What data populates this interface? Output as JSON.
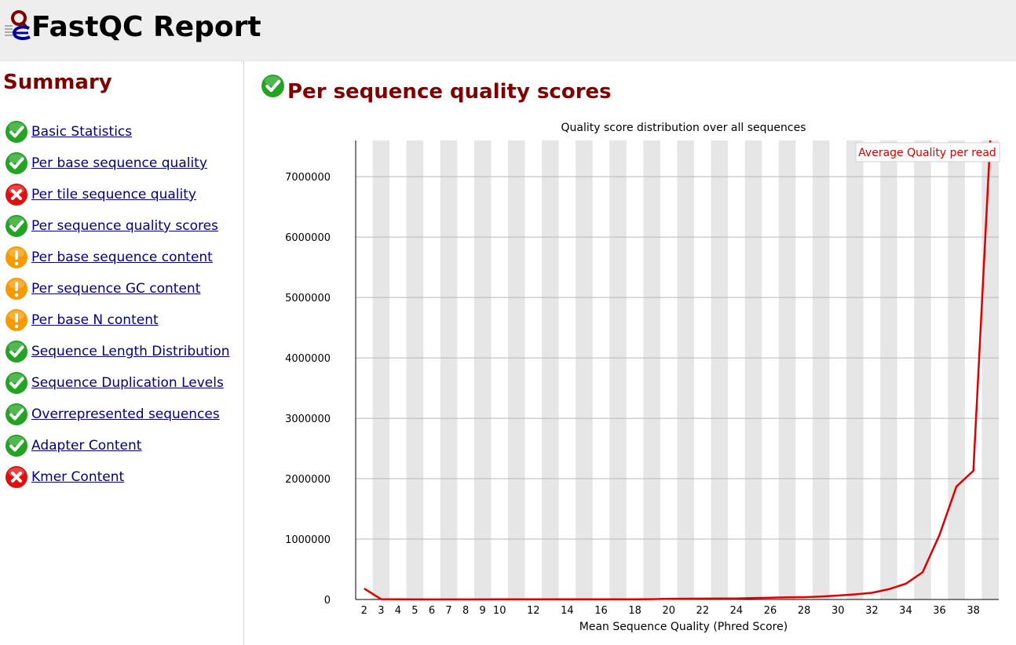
{
  "header": {
    "title": "FastQC Report"
  },
  "sidebar": {
    "title": "Summary",
    "modules": [
      {
        "label": "Basic Statistics",
        "status": "pass"
      },
      {
        "label": "Per base sequence quality",
        "status": "pass"
      },
      {
        "label": "Per tile sequence quality",
        "status": "fail"
      },
      {
        "label": "Per sequence quality scores",
        "status": "pass"
      },
      {
        "label": "Per base sequence content",
        "status": "warn"
      },
      {
        "label": "Per sequence GC content",
        "status": "warn"
      },
      {
        "label": "Per base N content",
        "status": "warn"
      },
      {
        "label": "Sequence Length Distribution",
        "status": "pass"
      },
      {
        "label": "Sequence Duplication Levels",
        "status": "pass"
      },
      {
        "label": "Overrepresented sequences",
        "status": "pass"
      },
      {
        "label": "Adapter Content",
        "status": "pass"
      },
      {
        "label": "Kmer Content",
        "status": "fail"
      }
    ]
  },
  "main": {
    "section_title": "Per sequence quality scores",
    "section_status": "pass"
  },
  "colors": {
    "title_red": "#800000",
    "link_blue": "#000080",
    "line_red": "#dd0000",
    "stripe_gray": "#e6e6e6",
    "pass_green": "#22a322",
    "warn_orange": "#f59a00",
    "fail_red": "#dd1111"
  },
  "chart_data": {
    "type": "line",
    "title": "Quality score distribution over all sequences",
    "xlabel": "Mean Sequence Quality (Phred Score)",
    "ylabel": "",
    "legend": "Average Quality per read",
    "legend_position": "top-right",
    "x_tick_labels": [
      "2",
      "3",
      "4",
      "5",
      "6",
      "7",
      "8",
      "9",
      "10",
      "12",
      "14",
      "16",
      "18",
      "20",
      "22",
      "24",
      "26",
      "28",
      "30",
      "32",
      "34",
      "36",
      "38"
    ],
    "y_ticks": [
      0,
      1000000,
      2000000,
      3000000,
      4000000,
      5000000,
      6000000,
      7000000
    ],
    "y_tick_labels": [
      "0",
      "1000000",
      "2000000",
      "3000000",
      "4000000",
      "5000000",
      "6000000",
      "7000000"
    ],
    "xlim": [
      2,
      39
    ],
    "ylim": [
      0,
      7600000
    ],
    "series": [
      {
        "name": "Average Quality per read",
        "x": [
          2,
          3,
          4,
          5,
          6,
          7,
          8,
          9,
          10,
          11,
          12,
          13,
          14,
          15,
          16,
          17,
          18,
          19,
          20,
          21,
          22,
          23,
          24,
          25,
          26,
          27,
          28,
          29,
          30,
          31,
          32,
          33,
          34,
          35,
          36,
          37,
          38,
          39
        ],
        "y": [
          180000,
          5000,
          2000,
          1500,
          1500,
          1500,
          1500,
          1500,
          2000,
          2000,
          2500,
          2500,
          3000,
          3000,
          3500,
          4000,
          4500,
          5000,
          12000,
          13000,
          14000,
          15000,
          16000,
          25000,
          28000,
          35000,
          38000,
          50000,
          65000,
          85000,
          110000,
          170000,
          260000,
          450000,
          1070000,
          1870000,
          2130000,
          7600000
        ]
      }
    ]
  }
}
